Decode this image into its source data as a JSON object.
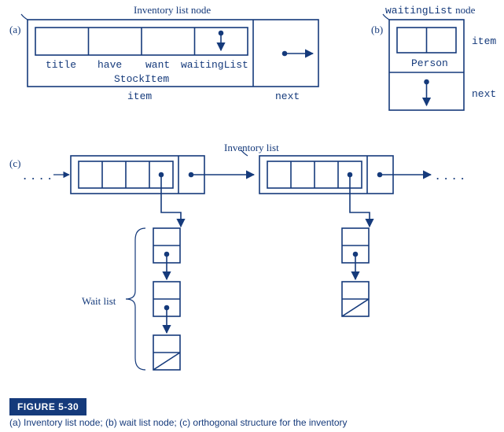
{
  "titles": {
    "a_title": "Inventory list node",
    "b_title_mono": "waitingList",
    "b_title_suffix": " node",
    "c_title": "Inventory list"
  },
  "labels": {
    "a": "(a)",
    "b": "(b)",
    "c": "(c)"
  },
  "a_fields": {
    "title": "title",
    "have": "have",
    "want": "want",
    "waitingList": "waitingList",
    "StockItem": "StockItem",
    "item": "item",
    "next": "next"
  },
  "b_fields": {
    "item": "item",
    "Person": "Person",
    "next": "next"
  },
  "c_fields": {
    "waitlist": "Wait list",
    "dots_left": ". . . .",
    "dots_right": ". . . ."
  },
  "figure": {
    "label": "FIGURE 5-30",
    "caption": "(a) Inventory list node; (b) wait list node; (c) orthogonal structure for the inventory"
  },
  "chart_data": {
    "type": "diagram",
    "description": "Textbook figure showing linked-list node structures for an inventory and waiting list.",
    "parts": [
      {
        "id": "a",
        "name": "Inventory list node",
        "node": {
          "item": {
            "type": "StockItem",
            "fields": [
              "title",
              "have",
              "want",
              "waitingList"
            ],
            "notes": "waitingList field shown as a pointer (downward arrow)"
          },
          "next": "pointer to next inventory list node"
        }
      },
      {
        "id": "b",
        "name": "waitingList node",
        "node": {
          "item": {
            "type": "Person",
            "fields": [
              "(two fields shown, unlabeled)"
            ]
          },
          "next": "pointer to next waitingList node (downward arrow)"
        }
      },
      {
        "id": "c",
        "name": "Inventory list (orthogonal structure)",
        "horizontal_list": {
          "nodes_drawn": 2,
          "ellipsis_before": true,
          "ellipsis_after": true,
          "each_node_waitingList_pointer": "points downward to a vertical wait list"
        },
        "wait_lists": [
          {
            "under_node": 1,
            "length_drawn": 3,
            "terminated_with_null": true,
            "bracket_label": "Wait list"
          },
          {
            "under_node": 2,
            "length_drawn": 2,
            "terminated_with_null": true
          }
        ]
      }
    ]
  }
}
